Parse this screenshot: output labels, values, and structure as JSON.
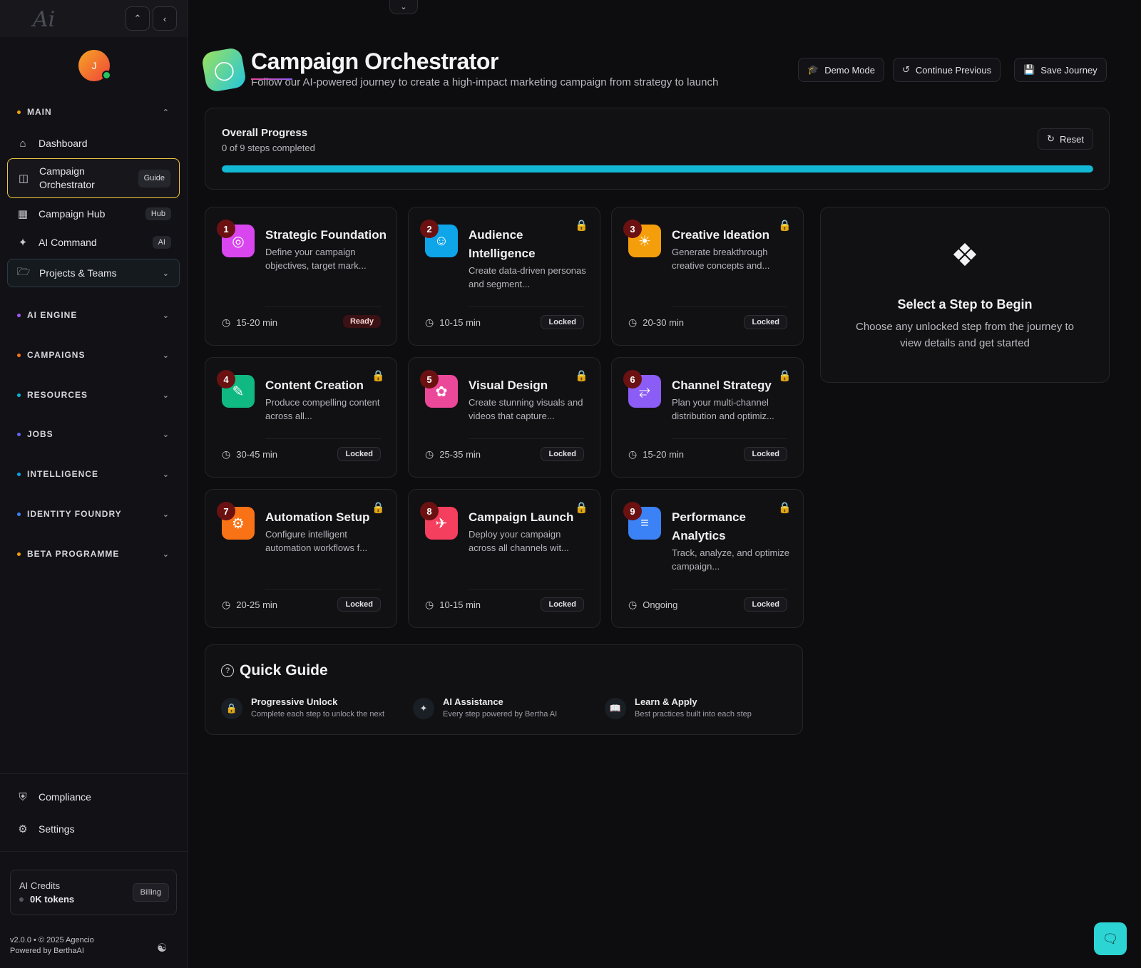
{
  "sidebar": {
    "logo": "Ai",
    "avatar_initial": "J",
    "sections": {
      "main": "MAIN",
      "ai_engine": "AI ENGINE",
      "campaigns": "CAMPAIGNS",
      "resources": "RESOURCES",
      "jobs": "JOBS",
      "intelligence": "INTELLIGENCE",
      "identity_foundry": "IDENTITY FOUNDRY",
      "beta_programme": "BETA PROGRAMME"
    },
    "section_colors": {
      "main": "#f59e0b",
      "ai_engine": "#a855f7",
      "campaigns": "#f97316",
      "resources": "#06b6d4",
      "jobs": "#6366f1",
      "intelligence": "#0ea5e9",
      "identity_foundry": "#3b82f6",
      "beta_programme": "#f59e0b"
    },
    "items": {
      "dashboard": "Dashboard",
      "campaign_orchestrator_1": "Campaign",
      "campaign_orchestrator_2": "Orchestrator",
      "campaign_orchestrator_tag": "Guide",
      "campaign_hub": "Campaign Hub",
      "campaign_hub_tag": "Hub",
      "ai_command": "AI Command",
      "ai_command_tag": "AI",
      "projects_teams": "Projects & Teams",
      "compliance": "Compliance",
      "settings": "Settings"
    },
    "credits": {
      "label": "AI Credits",
      "value": "0K tokens",
      "billing": "Billing"
    },
    "footer": {
      "version": "v2.0.0 • © 2025 Agencio",
      "powered": "Powered by BerthaAI"
    }
  },
  "header": {
    "title": "Campaign Orchestrator",
    "subtitle": "Follow our AI-powered journey to create a high-impact marketing campaign from strategy to launch",
    "demo_mode": "Demo Mode",
    "continue_previous": "Continue Previous",
    "save_journey": "Save Journey"
  },
  "progress": {
    "title": "Overall Progress",
    "status": "0 of 9 steps completed",
    "reset": "Reset",
    "fraction": 1.0
  },
  "steps": [
    {
      "num": "1",
      "title": "Strategic Foundation",
      "desc": "Define your campaign objectives, target mark...",
      "time": "15-20 min",
      "badge": "Ready",
      "icon": "target-icon",
      "color": "#d946ef"
    },
    {
      "num": "2",
      "title": "Audience Intelligence",
      "desc": "Create data-driven personas and segment...",
      "time": "10-15 min",
      "badge": "Locked",
      "icon": "users-icon",
      "color": "#0ea5e9"
    },
    {
      "num": "3",
      "title": "Creative Ideation",
      "desc": "Generate breakthrough creative concepts and...",
      "time": "20-30 min",
      "badge": "Locked",
      "icon": "lightbulb-icon",
      "color": "#f59e0b"
    },
    {
      "num": "4",
      "title": "Content Creation",
      "desc": "Produce compelling content across all...",
      "time": "30-45 min",
      "badge": "Locked",
      "icon": "pen-icon",
      "color": "#10b981"
    },
    {
      "num": "5",
      "title": "Visual Design",
      "desc": "Create stunning visuals and videos that capture...",
      "time": "25-35 min",
      "badge": "Locked",
      "icon": "palette-icon",
      "color": "#ec4899"
    },
    {
      "num": "6",
      "title": "Channel Strategy",
      "desc": "Plan your multi-channel distribution and optimiz...",
      "time": "15-20 min",
      "badge": "Locked",
      "icon": "share-icon",
      "color": "#8b5cf6"
    },
    {
      "num": "7",
      "title": "Automation Setup",
      "desc": "Configure intelligent automation workflows f...",
      "time": "20-25 min",
      "badge": "Locked",
      "icon": "robot-icon",
      "color": "#f97316"
    },
    {
      "num": "8",
      "title": "Campaign Launch",
      "desc": "Deploy your campaign across all channels wit...",
      "time": "10-15 min",
      "badge": "Locked",
      "icon": "rocket-icon",
      "color": "#f43f5e"
    },
    {
      "num": "9",
      "title": "Performance Analytics",
      "desc": "Track, analyze, and optimize campaign...",
      "time": "Ongoing",
      "badge": "Locked",
      "icon": "chart-icon",
      "color": "#3b82f6"
    }
  ],
  "select_panel": {
    "title": "Select a Step to Begin",
    "subtitle": "Choose any unlocked step from the journey to view details and get started"
  },
  "quick_guide": {
    "title": "Quick Guide",
    "items": [
      {
        "title": "Progressive Unlock",
        "sub": "Complete each step to unlock the next"
      },
      {
        "title": "AI Assistance",
        "sub": "Every step powered by Bertha AI"
      },
      {
        "title": "Learn & Apply",
        "sub": "Best practices built into each step"
      }
    ]
  }
}
